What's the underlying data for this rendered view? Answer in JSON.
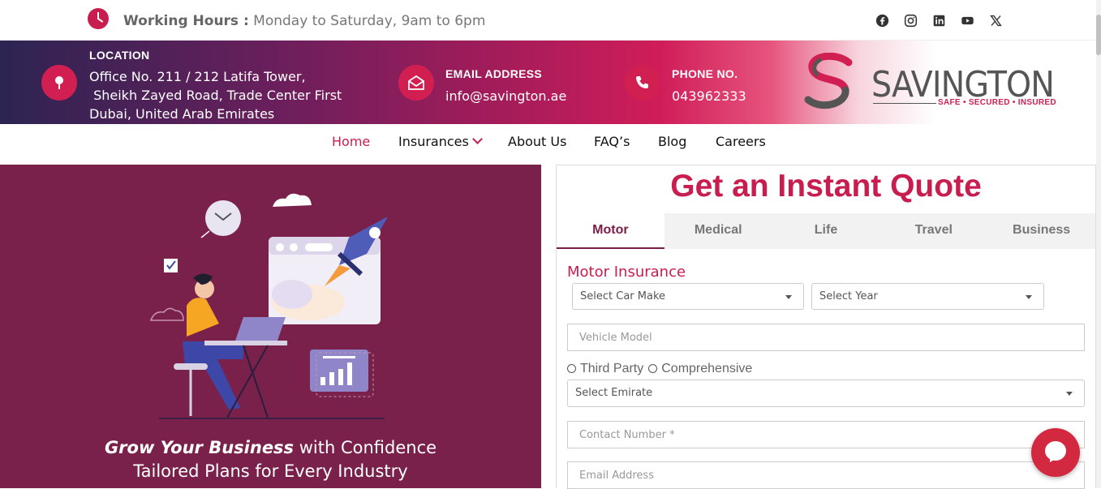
{
  "topbar": {
    "hours_label": "Working Hours :",
    "hours_value": " Monday to Saturday, 9am to 6pm",
    "socials": [
      "facebook-icon",
      "instagram-icon",
      "linkedin-icon",
      "youtube-icon",
      "x-icon"
    ]
  },
  "banner": {
    "location_label": "LOCATION",
    "location_line1": "Office No. 211 / 212 Latifa Tower,",
    "location_line2": " Sheikh Zayed Road, Trade Center First",
    "location_line3": "Dubai, United Arab Emirates",
    "email_label": "EMAIL ADDRESS",
    "email_value": "info@savington.ae",
    "phone_label": "PHONE NO.",
    "phone_value": "043962333"
  },
  "logo": {
    "name": "SAVINGTON",
    "tagline": "SAFE • SECURED • INSURED"
  },
  "nav": {
    "items": [
      "Home",
      "Insurances",
      "About Us",
      "FAQ’s",
      "Blog",
      "Careers"
    ]
  },
  "hero": {
    "title_bold": "Grow Your Business",
    "title_rest": " with Confidence",
    "subtitle": "Tailored Plans for Every Industry"
  },
  "quote": {
    "title": "Get an Instant Quote",
    "tabs": [
      "Motor",
      "Medical",
      "Life",
      "Travel",
      "Business"
    ],
    "active_tab": "Motor",
    "section_title": "Motor Insurance",
    "car_make": "Select Car Make",
    "year": "Select Year",
    "vehicle_model_placeholder": "Vehicle Model",
    "radio_third_party": "Third Party",
    "radio_comprehensive": "Comprehensive",
    "emirate": "Select Emirate",
    "contact_placeholder": "Contact Number *",
    "email_placeholder": "Email Address"
  },
  "colors": {
    "accent": "#c81d4f",
    "hero_bg": "#79214b",
    "tab_active": "#7a1d47"
  }
}
